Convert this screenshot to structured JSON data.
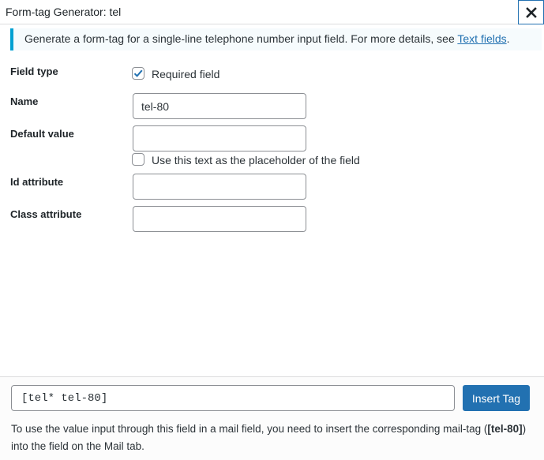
{
  "header": {
    "title": "Form-tag Generator: tel",
    "close_icon": "close-icon"
  },
  "notice": {
    "text": "Generate a form-tag for a single-line telephone number input field. For more details, see ",
    "link_text": "Text fields",
    "suffix": ".",
    "accent_color": "#00a0d2"
  },
  "fields": {
    "field_type": {
      "label": "Field type",
      "checkbox_label": "Required field",
      "checked": true
    },
    "name": {
      "label": "Name",
      "value": "tel-80"
    },
    "default_value": {
      "label": "Default value",
      "value": "",
      "placeholder_checkbox_label": "Use this text as the placeholder of the field",
      "placeholder_checked": false
    },
    "id_attribute": {
      "label": "Id attribute",
      "value": ""
    },
    "class_attribute": {
      "label": "Class attribute",
      "value": ""
    }
  },
  "footer": {
    "tag_value": "[tel* tel-80]",
    "insert_label": "Insert Tag",
    "note_before": "To use the value input through this field in a mail field, you need to insert the corresponding mail-tag (",
    "note_tag": "[tel-80]",
    "note_after": ") into the field on the Mail tab.",
    "primary_color": "#2271b1"
  }
}
